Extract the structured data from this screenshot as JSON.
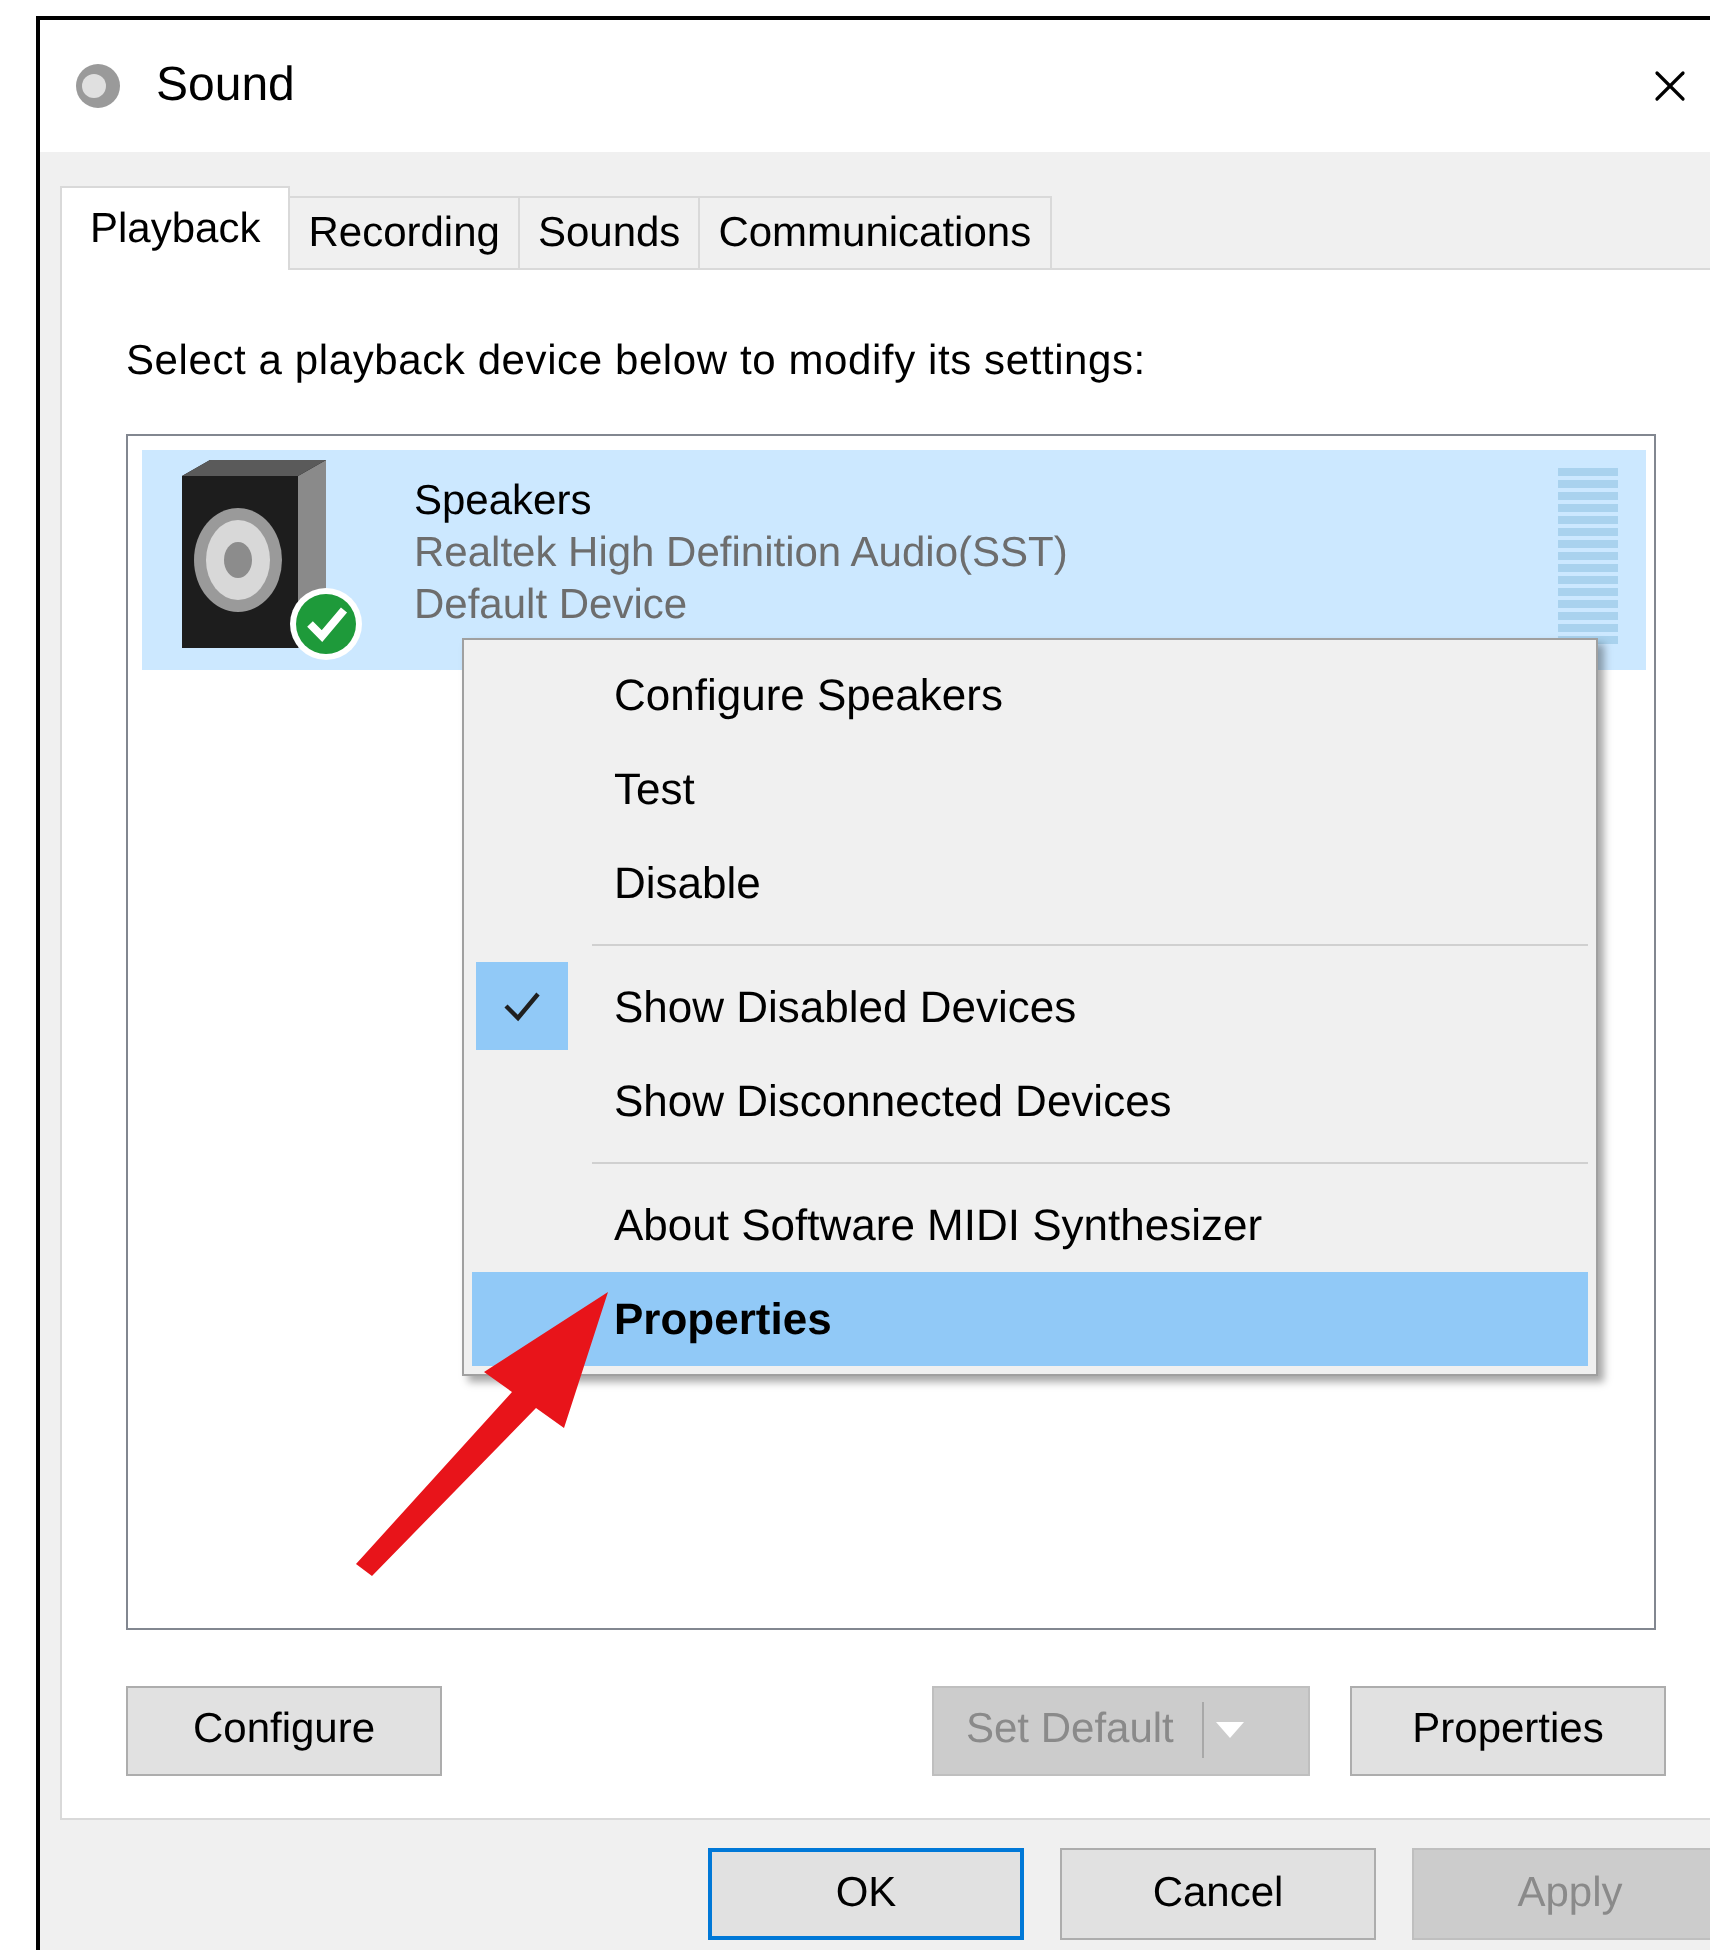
{
  "window": {
    "title": "Sound"
  },
  "tabs": [
    {
      "label": "Playback",
      "selected": true
    },
    {
      "label": "Recording",
      "selected": false
    },
    {
      "label": "Sounds",
      "selected": false
    },
    {
      "label": "Communications",
      "selected": false
    }
  ],
  "instruction": "Select a playback device below to modify its settings:",
  "devices": [
    {
      "name": "Speakers",
      "driver": "Realtek High Definition Audio(SST)",
      "status": "Default Device",
      "selected": true,
      "default": true
    }
  ],
  "context_menu": [
    {
      "kind": "item",
      "label": "Configure Speakers",
      "checked": false,
      "selected": false
    },
    {
      "kind": "item",
      "label": "Test",
      "checked": false,
      "selected": false
    },
    {
      "kind": "item",
      "label": "Disable",
      "checked": false,
      "selected": false
    },
    {
      "kind": "separator"
    },
    {
      "kind": "item",
      "label": "Show Disabled Devices",
      "checked": true,
      "selected": false
    },
    {
      "kind": "item",
      "label": "Show Disconnected Devices",
      "checked": false,
      "selected": false
    },
    {
      "kind": "separator"
    },
    {
      "kind": "item",
      "label": "About Software MIDI Synthesizer",
      "checked": false,
      "selected": false
    },
    {
      "kind": "item",
      "label": "Properties",
      "checked": false,
      "selected": true
    }
  ],
  "panel_buttons": [
    {
      "kind": "plain",
      "label": "Configure",
      "disabled": false
    },
    {
      "kind": "split",
      "label": "Set Default",
      "disabled": true
    },
    {
      "kind": "plain",
      "label": "Properties",
      "disabled": false
    }
  ],
  "dialog_buttons": [
    {
      "label": "OK",
      "default": true,
      "disabled": false
    },
    {
      "label": "Cancel",
      "default": false,
      "disabled": false
    },
    {
      "label": "Apply",
      "default": false,
      "disabled": true
    }
  ]
}
